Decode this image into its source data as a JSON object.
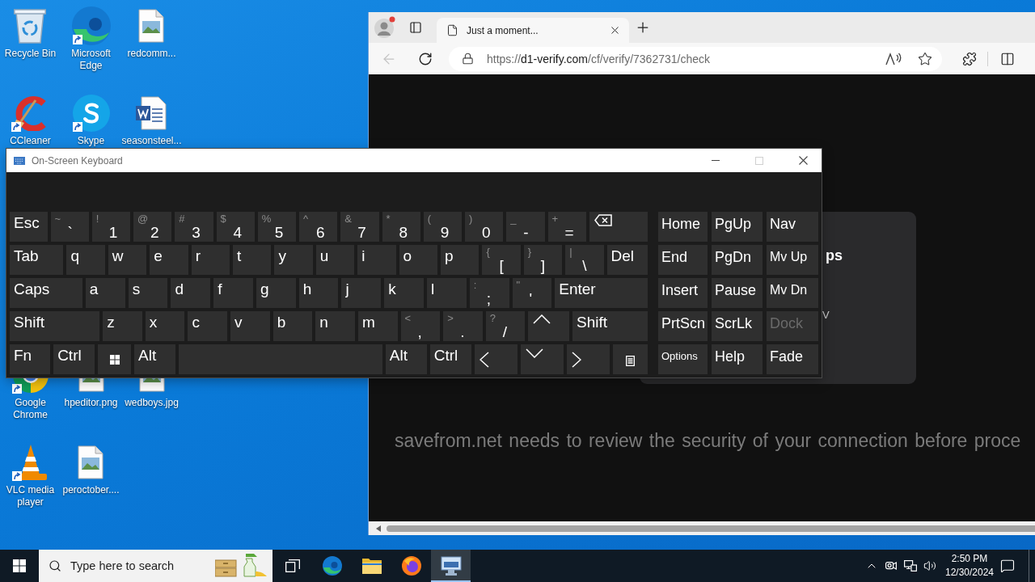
{
  "desktop_icons_top": [
    {
      "kind": "bin",
      "label": "Recycle Bin",
      "shortcut": false
    },
    {
      "kind": "edge",
      "label": "Microsoft Edge",
      "shortcut": true
    },
    {
      "kind": "image",
      "label": "redcomm...",
      "shortcut": false
    },
    {
      "kind": "cleaner",
      "label": "CCleaner",
      "shortcut": true
    },
    {
      "kind": "skype",
      "label": "Skype",
      "shortcut": true
    },
    {
      "kind": "document",
      "label": "seasonsteel...",
      "shortcut": false
    }
  ],
  "desktop_icons_bottom": [
    {
      "kind": "chrome",
      "label": "Google Chrome",
      "shortcut": true
    },
    {
      "kind": "image",
      "label": "hpeditor.png",
      "shortcut": false
    },
    {
      "kind": "image",
      "label": "wedboys.jpg",
      "shortcut": false
    },
    {
      "kind": "cone",
      "label": "VLC media player",
      "shortcut": true
    },
    {
      "kind": "image",
      "label": "peroctober....",
      "shortcut": false
    }
  ],
  "browser": {
    "tabs": [
      {
        "title": "Just a moment...",
        "selected": true
      }
    ],
    "back": {
      "disabled": true
    },
    "address": {
      "scheme": "https://",
      "host": "d1-verify.com",
      "path": "/cf/verify/7362731/check"
    },
    "page": {
      "card": {
        "heading": "ps",
        "text": "V"
      },
      "message": "savefrom.net needs to review the security of your connection before proce"
    }
  },
  "keyboard": {
    "title": "On-Screen Keyboard",
    "maximize": {
      "disabled": true
    },
    "keys": [
      [
        {
          "kind": "text",
          "label": "Esc"
        },
        {
          "kind": "dual",
          "shift": "~",
          "label": "`"
        },
        {
          "kind": "dual",
          "shift": "!",
          "label": "1"
        },
        {
          "kind": "dual",
          "shift": "@",
          "label": "2"
        },
        {
          "kind": "dual",
          "shift": "#",
          "label": "3"
        },
        {
          "kind": "dual",
          "shift": "$",
          "label": "4"
        },
        {
          "kind": "dual",
          "shift": "%",
          "label": "5"
        },
        {
          "kind": "dual",
          "shift": "^",
          "label": "6"
        },
        {
          "kind": "dual",
          "shift": "&",
          "label": "7"
        },
        {
          "kind": "dual",
          "shift": "*",
          "label": "8"
        },
        {
          "kind": "dual",
          "shift": "(",
          "label": "9"
        },
        {
          "kind": "dual",
          "shift": ")",
          "label": "0"
        },
        {
          "kind": "dual",
          "shift": "_",
          "label": "-"
        },
        {
          "kind": "dual",
          "shift": "+",
          "label": "="
        },
        {
          "kind": "backspace"
        }
      ],
      [
        {
          "kind": "text",
          "label": "Tab"
        },
        {
          "kind": "text",
          "label": "q"
        },
        {
          "kind": "text",
          "label": "w"
        },
        {
          "kind": "text",
          "label": "e"
        },
        {
          "kind": "text",
          "label": "r"
        },
        {
          "kind": "text",
          "label": "t"
        },
        {
          "kind": "text",
          "label": "y"
        },
        {
          "kind": "text",
          "label": "u"
        },
        {
          "kind": "text",
          "label": "i"
        },
        {
          "kind": "text",
          "label": "o"
        },
        {
          "kind": "text",
          "label": "p"
        },
        {
          "kind": "dual",
          "shift": "{",
          "label": "["
        },
        {
          "kind": "dual",
          "shift": "}",
          "label": "]"
        },
        {
          "kind": "dual",
          "shift": "|",
          "label": "\\"
        },
        {
          "kind": "text",
          "label": "Del"
        }
      ],
      [
        {
          "kind": "text",
          "label": "Caps"
        },
        {
          "kind": "text",
          "label": "a"
        },
        {
          "kind": "text",
          "label": "s"
        },
        {
          "kind": "text",
          "label": "d"
        },
        {
          "kind": "text",
          "label": "f"
        },
        {
          "kind": "text",
          "label": "g"
        },
        {
          "kind": "text",
          "label": "h"
        },
        {
          "kind": "text",
          "label": "j"
        },
        {
          "kind": "text",
          "label": "k"
        },
        {
          "kind": "text",
          "label": "l"
        },
        {
          "kind": "dual",
          "shift": ":",
          "label": ";"
        },
        {
          "kind": "dual",
          "shift": "\"",
          "label": "'"
        },
        {
          "kind": "text",
          "label": "Enter"
        }
      ],
      [
        {
          "kind": "text",
          "label": "Shift"
        },
        {
          "kind": "text",
          "label": "z"
        },
        {
          "kind": "text",
          "label": "x"
        },
        {
          "kind": "text",
          "label": "c"
        },
        {
          "kind": "text",
          "label": "v"
        },
        {
          "kind": "text",
          "label": "b"
        },
        {
          "kind": "text",
          "label": "n"
        },
        {
          "kind": "text",
          "label": "m"
        },
        {
          "kind": "dual",
          "shift": "<",
          "label": ","
        },
        {
          "kind": "dual",
          "shift": ">",
          "label": "."
        },
        {
          "kind": "dual",
          "shift": "?",
          "label": "/"
        },
        {
          "kind": "up"
        },
        {
          "kind": "text",
          "label": "Shift"
        }
      ],
      [
        {
          "kind": "text",
          "label": "Fn"
        },
        {
          "kind": "text",
          "label": "Ctrl"
        },
        {
          "kind": "windows"
        },
        {
          "kind": "text",
          "label": "Alt"
        },
        {
          "kind": "space"
        },
        {
          "kind": "text",
          "label": "Alt"
        },
        {
          "kind": "text",
          "label": "Ctrl"
        },
        {
          "kind": "left"
        },
        {
          "kind": "down"
        },
        {
          "kind": "right"
        },
        {
          "kind": "menu"
        }
      ]
    ],
    "nav_keys": [
      [
        {
          "kind": "text",
          "label": "Home",
          "disabled": false
        },
        {
          "kind": "text",
          "label": "PgUp",
          "disabled": false
        },
        {
          "kind": "text",
          "label": "Nav",
          "disabled": false
        }
      ],
      [
        {
          "kind": "text",
          "label": "End",
          "disabled": false
        },
        {
          "kind": "text",
          "label": "PgDn",
          "disabled": false
        },
        {
          "kind": "compact",
          "label": "Mv Up",
          "disabled": false
        }
      ],
      [
        {
          "kind": "text",
          "label": "Insert",
          "disabled": false
        },
        {
          "kind": "text",
          "label": "Pause",
          "disabled": false
        },
        {
          "kind": "compact",
          "label": "Mv Dn",
          "disabled": false
        }
      ],
      [
        {
          "kind": "text",
          "label": "PrtScn",
          "disabled": false
        },
        {
          "kind": "text",
          "label": "ScrLk",
          "disabled": false
        },
        {
          "kind": "text",
          "label": "Dock",
          "disabled": true
        }
      ],
      [
        {
          "kind": "small",
          "label": "Options",
          "disabled": false
        },
        {
          "kind": "text",
          "label": "Help",
          "disabled": false
        },
        {
          "kind": "text",
          "label": "Fade",
          "disabled": false
        }
      ]
    ]
  },
  "taskbar": {
    "search": {
      "placeholder": "Type here to search"
    },
    "apps": [
      {
        "kind": "taskview",
        "active": false
      },
      {
        "kind": "edge",
        "active": false
      },
      {
        "kind": "folder",
        "active": false
      },
      {
        "kind": "firefox",
        "active": false
      },
      {
        "kind": "keyboard",
        "active": true
      }
    ],
    "clock": {
      "time": "2:50 PM",
      "date": "12/30/2024"
    }
  }
}
